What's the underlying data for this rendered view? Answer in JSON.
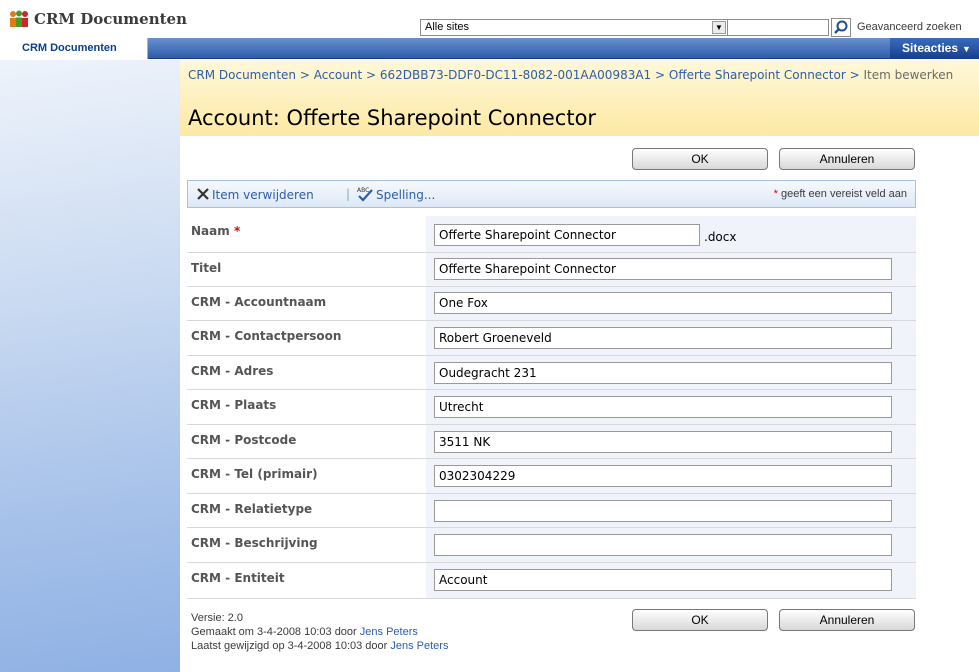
{
  "header": {
    "site_title": "CRM Documenten",
    "search_scope": "Alle sites",
    "search_value": "",
    "advanced_search": "Geavanceerd zoeken"
  },
  "nav": {
    "tab": "CRM Documenten",
    "site_actions": "Siteacties"
  },
  "breadcrumb": {
    "parts": [
      "CRM Documenten",
      "Account",
      "662DBB73-DDF0-DC11-8082-001AA00983A1",
      "Offerte Sharepoint Connector"
    ],
    "tail": "Item bewerken",
    "separator": " > "
  },
  "page_title": "Account: Offerte Sharepoint Connector",
  "buttons": {
    "ok": "OK",
    "cancel": "Annuleren"
  },
  "toolbar": {
    "delete": "Item verwijderen",
    "separator": "|",
    "spelling": "Spelling...",
    "required_star": "*",
    "required_note": "geeft een vereist veld aan"
  },
  "form": {
    "fields": [
      {
        "label": "Naam",
        "required": "*",
        "value": "Offerte Sharepoint Connector",
        "suffix": ".docx"
      },
      {
        "label": "Titel",
        "value": "Offerte Sharepoint Connector"
      },
      {
        "label": "CRM - Accountnaam",
        "value": "One Fox"
      },
      {
        "label": "CRM - Contactpersoon",
        "value": "Robert Groeneveld"
      },
      {
        "label": "CRM - Adres",
        "value": "Oudegracht 231"
      },
      {
        "label": "CRM - Plaats",
        "value": "Utrecht"
      },
      {
        "label": "CRM - Postcode",
        "value": "3511 NK"
      },
      {
        "label": "CRM - Tel (primair)",
        "value": "0302304229"
      },
      {
        "label": "CRM - Relatietype",
        "value": ""
      },
      {
        "label": "CRM - Beschrijving",
        "value": ""
      },
      {
        "label": "CRM - Entiteit",
        "value": "Account"
      }
    ]
  },
  "footer": {
    "version": "Versie: 2.0",
    "created_prefix": "Gemaakt om 3-4-2008 10:03  door",
    "created_by": "Jens Peters",
    "modified_prefix": "Laatst gewijzigd op 3-4-2008 10:03  door",
    "modified_by": "Jens Peters"
  },
  "colors": {
    "nav_blue": "#2d5da9",
    "title_area": "#fde9a4",
    "link": "#2d5da9",
    "required": "#e00000"
  }
}
